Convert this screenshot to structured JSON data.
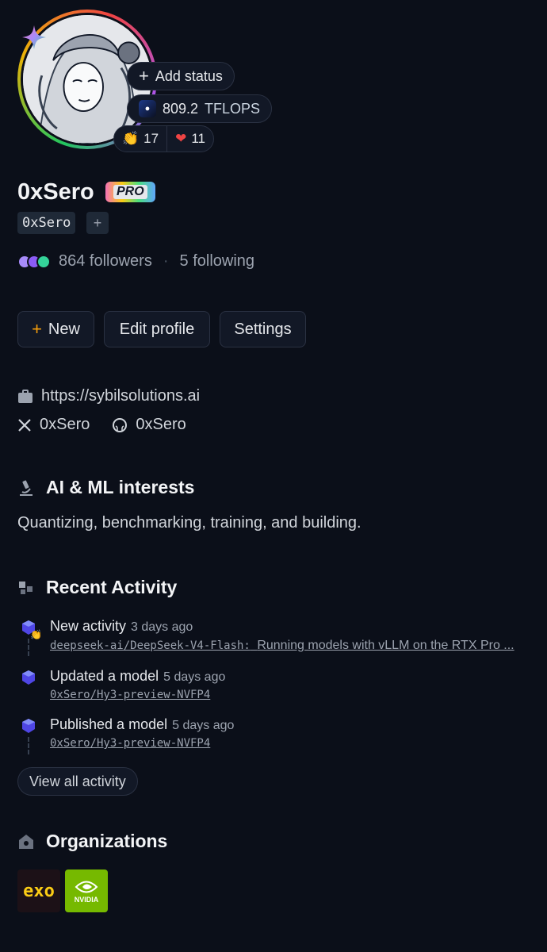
{
  "profile": {
    "status_button": "Add status",
    "tflops_value": "809.2",
    "tflops_unit": "TFLOPS",
    "reaction_clap": "17",
    "reaction_heart": "11",
    "name": "0xSero",
    "pro_badge": "PRO",
    "handle": "0xSero",
    "handle_add": "+",
    "followers": "864 followers",
    "following": "5 following"
  },
  "actions": {
    "new_label": "New",
    "edit_label": "Edit profile",
    "settings_label": "Settings"
  },
  "links": {
    "website": "https://sybilsolutions.ai",
    "x_handle": "0xSero",
    "github_handle": "0xSero"
  },
  "interests": {
    "title": "AI & ML interests",
    "text": "Quantizing, benchmarking, training, and building."
  },
  "activity": {
    "title": "Recent Activity",
    "items": [
      {
        "action": "New activity",
        "time": "3 days ago",
        "link": "deepseek-ai/DeepSeek-V4-Flash:",
        "desc": "Running models with vLLM on the RTX Pro ..."
      },
      {
        "action": "Updated a model",
        "time": "5 days ago",
        "link": "0xSero/Hy3-preview-NVFP4"
      },
      {
        "action": "Published a model",
        "time": "5 days ago",
        "link": "0xSero/Hy3-preview-NVFP4"
      }
    ],
    "view_all": "View all activity"
  },
  "organizations": {
    "title": "Organizations",
    "items": [
      {
        "name": "exo"
      },
      {
        "name": "NVIDIA"
      }
    ]
  },
  "colors": {
    "background": "#0b0f19",
    "accent_orange": "#f59e0b",
    "nvidia_green": "#76b900",
    "activity_cube": "#4f46e5"
  }
}
